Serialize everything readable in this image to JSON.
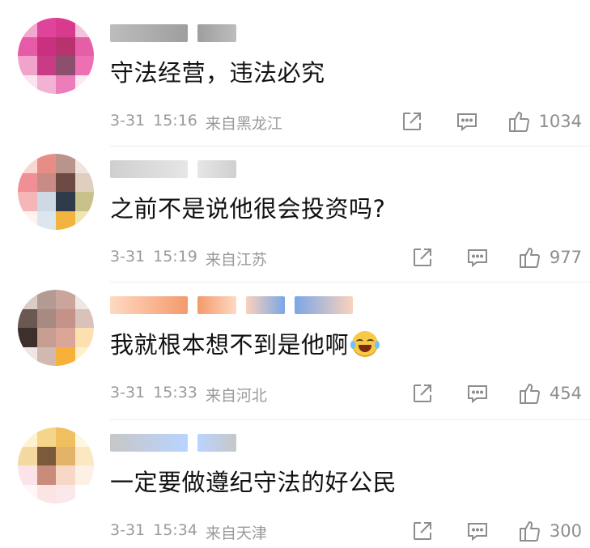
{
  "comments": [
    {
      "text": "守法经营，违法必究",
      "date": "3-31",
      "time": "15:16",
      "location": "来自黑龙江",
      "likes": "1034",
      "has_emoji": false,
      "avatar_colors": [
        "#f2a9cf",
        "#e0449a",
        "#d83a8e",
        "#f6c1dc",
        "#e75aa8",
        "#c9307f",
        "#b8336e",
        "#e55fa6",
        "#f1a3cb",
        "#c83c86",
        "#8c4f6e",
        "#ef6fb3",
        "#fbe4ef",
        "#f1b2d3",
        "#ec7cba",
        "#fde9f2"
      ],
      "name_colors": [
        [
          "#bdbdbd",
          "#9e9e9e"
        ]
      ]
    },
    {
      "text": "之前不是说他很会投资吗?",
      "date": "3-31",
      "time": "15:19",
      "location": "来自江苏",
      "likes": "977",
      "has_emoji": false,
      "avatar_colors": [
        "#f9d7d0",
        "#e78d86",
        "#b9948d",
        "#efe4e0",
        "#f08f96",
        "#c98b85",
        "#6e4a45",
        "#dfcfbf",
        "#f4b6b6",
        "#cfd9e4",
        "#2f3a4a",
        "#c9c18a",
        "#fff3ef",
        "#dbe6ef",
        "#f3b43f",
        "#f2e6b0"
      ],
      "name_colors": [
        [
          "#cfcfcf",
          "#e6e6e6"
        ]
      ]
    },
    {
      "text": "我就根本想不到是他啊",
      "date": "3-31",
      "time": "15:33",
      "location": "来自河北",
      "likes": "454",
      "has_emoji": true,
      "avatar_colors": [
        "#d9cbc7",
        "#b39a93",
        "#c9a59c",
        "#efe7e3",
        "#6b5853",
        "#a78a82",
        "#c49289",
        "#d8c2b9",
        "#3d2f2c",
        "#c79d92",
        "#dba598",
        "#fce0b0",
        "#efe7e3",
        "#cfb9b1",
        "#f7b13a",
        "#fff0cc"
      ],
      "name_colors": [
        [
          "#ffd9c2",
          "#f39a6b"
        ],
        [
          "#fbd1bc",
          "#7aa7e6"
        ]
      ]
    },
    {
      "text": "一定要做遵纪守法的好公民",
      "date": "3-31",
      "time": "15:34",
      "location": "来自天津",
      "likes": "300",
      "has_emoji": false,
      "avatar_colors": [
        "#fff2d1",
        "#f5d58a",
        "#f0c060",
        "#fff6e0",
        "#f3d9a0",
        "#7a5a3a",
        "#e3b36a",
        "#fce8c0",
        "#fbe3e8",
        "#c98b7a",
        "#f7d7c6",
        "#fdf1e6",
        "#fff7f7",
        "#fce4e4",
        "#fbe8ea",
        "#ffffff"
      ],
      "name_colors": [
        [
          "#c7c7c7",
          "#b9d4ff"
        ]
      ]
    }
  ]
}
